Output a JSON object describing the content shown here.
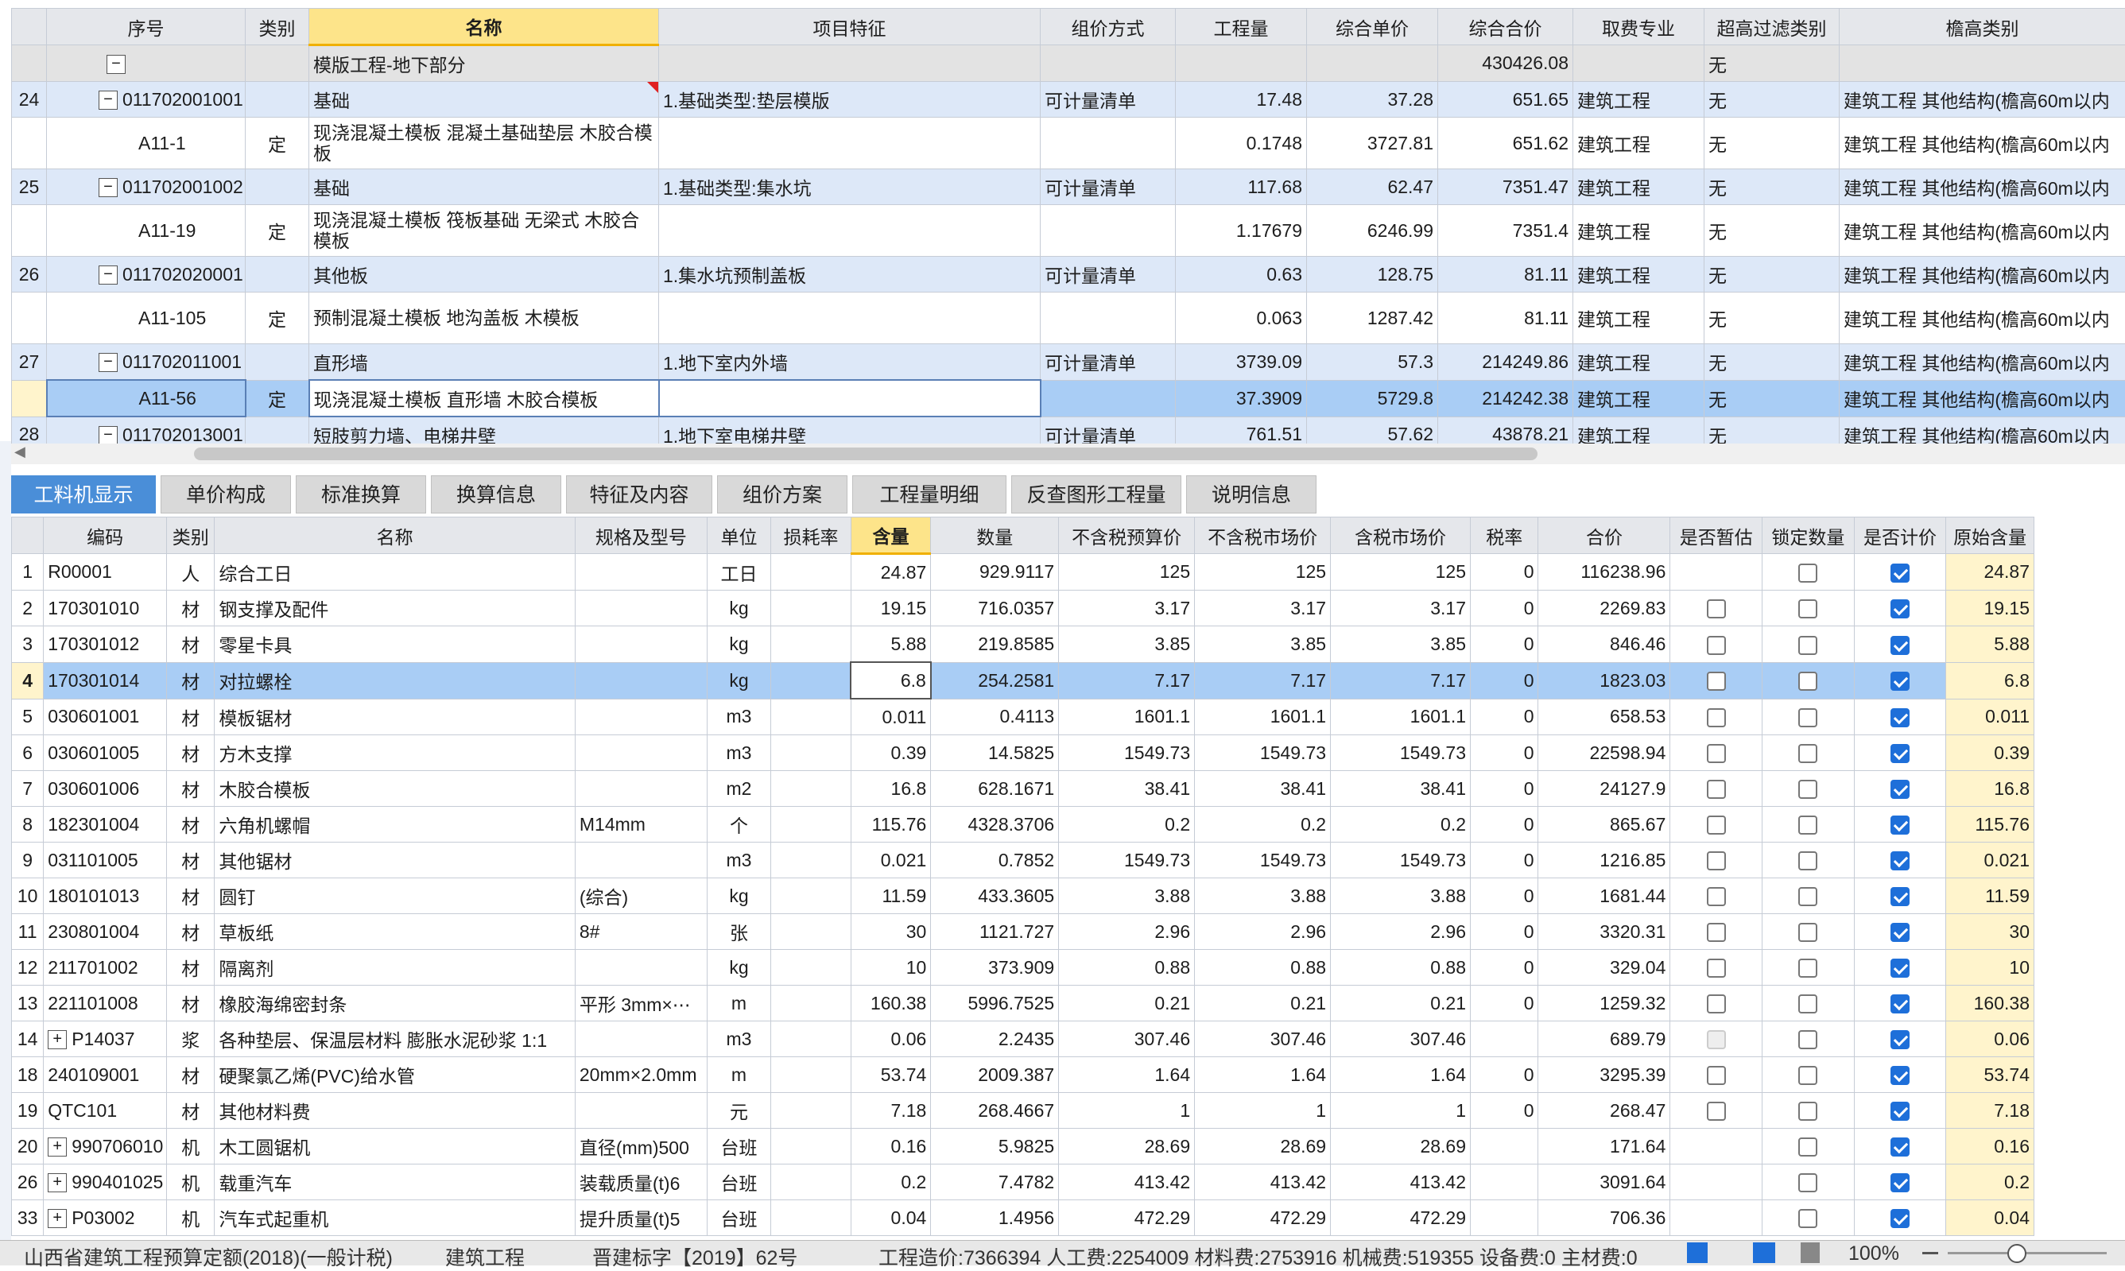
{
  "top_headers": [
    "序号",
    "类别",
    "名称",
    "项目特征",
    "组价方式",
    "工程量",
    "综合单价",
    "综合合价",
    "取费专业",
    "超高过滤类别",
    "檐高类别"
  ],
  "top_rows": [
    {
      "seq": "",
      "code": "",
      "type": "",
      "name": "模版工程-地下部分",
      "feat": "",
      "method": "",
      "qty": "",
      "price": "",
      "total": "430426.08",
      "fee": "",
      "filter": "无",
      "height": "",
      "style": "gray"
    },
    {
      "seq": "24",
      "code": "011702001001",
      "type": "",
      "name": "基础",
      "feat": "1.基础类型:垫层模版",
      "method": "可计量清单",
      "qty": "17.48",
      "price": "37.28",
      "total": "651.65",
      "fee": "建筑工程",
      "filter": "无",
      "height": "建筑工程 其他结构(檐高60m以内",
      "style": "blue"
    },
    {
      "seq": "",
      "code": "A11-1",
      "type": "定",
      "name": "现浇混凝土模板 混凝土基础垫层 木胶合模板",
      "feat": "",
      "method": "",
      "qty": "0.1748",
      "price": "3727.81",
      "total": "651.62",
      "fee": "建筑工程",
      "filter": "无",
      "height": "建筑工程 其他结构(檐高60m以内",
      "style": "white"
    },
    {
      "seq": "25",
      "code": "011702001002",
      "type": "",
      "name": "基础",
      "feat": "1.基础类型:集水坑",
      "method": "可计量清单",
      "qty": "117.68",
      "price": "62.47",
      "total": "7351.47",
      "fee": "建筑工程",
      "filter": "无",
      "height": "建筑工程 其他结构(檐高60m以内",
      "style": "blue"
    },
    {
      "seq": "",
      "code": "A11-19",
      "type": "定",
      "name": "现浇混凝土模板 筏板基础 无梁式 木胶合模板",
      "feat": "",
      "method": "",
      "qty": "1.17679",
      "price": "6246.99",
      "total": "7351.4",
      "fee": "建筑工程",
      "filter": "无",
      "height": "建筑工程 其他结构(檐高60m以内",
      "style": "white"
    },
    {
      "seq": "26",
      "code": "011702020001",
      "type": "",
      "name": "其他板",
      "feat": "1.集水坑预制盖板",
      "method": "可计量清单",
      "qty": "0.63",
      "price": "128.75",
      "total": "81.11",
      "fee": "建筑工程",
      "filter": "无",
      "height": "建筑工程 其他结构(檐高60m以内",
      "style": "blue"
    },
    {
      "seq": "",
      "code": "A11-105",
      "type": "定",
      "name": "预制混凝土模板 地沟盖板 木模板",
      "feat": "",
      "method": "",
      "qty": "0.063",
      "price": "1287.42",
      "total": "81.11",
      "fee": "建筑工程",
      "filter": "无",
      "height": "建筑工程 其他结构(檐高60m以内",
      "style": "white"
    },
    {
      "seq": "27",
      "code": "011702011001",
      "type": "",
      "name": "直形墙",
      "feat": "1.地下室内外墙",
      "method": "可计量清单",
      "qty": "3739.09",
      "price": "57.3",
      "total": "214249.86",
      "fee": "建筑工程",
      "filter": "无",
      "height": "建筑工程 其他结构(檐高60m以内",
      "style": "blue"
    },
    {
      "seq": "",
      "code": "A11-56",
      "type": "定",
      "name": "现浇混凝土模板 直形墙 木胶合模板",
      "feat": "",
      "method": "",
      "qty": "37.3909",
      "price": "5729.8",
      "total": "214242.38",
      "fee": "建筑工程",
      "filter": "无",
      "height": "建筑工程 其他结构(檐高60m以内",
      "style": "selrow"
    },
    {
      "seq": "28",
      "code": "011702013001",
      "type": "",
      "name": "短肢剪力墙、电梯井壁",
      "feat": "1.地下室电梯井壁",
      "method": "可计量清单",
      "qty": "761.51",
      "price": "57.62",
      "total": "43878.21",
      "fee": "建筑工程",
      "filter": "无",
      "height": "建筑工程 其他结构(檐高60m以内",
      "style": "blue"
    }
  ],
  "tabs": [
    "工料机显示",
    "单价构成",
    "标准换算",
    "换算信息",
    "特征及内容",
    "组价方案",
    "工程量明细",
    "反查图形工程量",
    "说明信息"
  ],
  "bottom_headers": [
    "编码",
    "类别",
    "名称",
    "规格及型号",
    "单位",
    "损耗率",
    "含量",
    "数量",
    "不含税预算价",
    "不含税市场价",
    "含税市场价",
    "税率",
    "合价",
    "是否暂估",
    "锁定数量",
    "是否计价",
    "原始含量"
  ],
  "bottom_rows": [
    {
      "n": "1",
      "code": "R00001",
      "exp": false,
      "type": "人",
      "name": "综合工日",
      "spec": "",
      "unit": "工日",
      "loss": "",
      "content": "24.87",
      "qty": "929.9117",
      "p1": "125",
      "p2": "125",
      "p3": "125",
      "tax": "0",
      "sum": "116238.96",
      "est": "none",
      "lock": "off",
      "price": "on",
      "orig": "24.87"
    },
    {
      "n": "2",
      "code": "170301010",
      "exp": false,
      "type": "材",
      "name": "钢支撑及配件",
      "spec": "",
      "unit": "kg",
      "loss": "",
      "content": "19.15",
      "qty": "716.0357",
      "p1": "3.17",
      "p2": "3.17",
      "p3": "3.17",
      "tax": "0",
      "sum": "2269.83",
      "est": "off",
      "lock": "off",
      "price": "on",
      "orig": "19.15"
    },
    {
      "n": "3",
      "code": "170301012",
      "exp": false,
      "type": "材",
      "name": "零星卡具",
      "spec": "",
      "unit": "kg",
      "loss": "",
      "content": "5.88",
      "qty": "219.8585",
      "p1": "3.85",
      "p2": "3.85",
      "p3": "3.85",
      "tax": "0",
      "sum": "846.46",
      "est": "off",
      "lock": "off",
      "price": "on",
      "orig": "5.88"
    },
    {
      "n": "4",
      "code": "170301014",
      "exp": false,
      "type": "材",
      "name": "对拉螺栓",
      "spec": "",
      "unit": "kg",
      "loss": "",
      "content": "6.8",
      "qty": "254.2581",
      "p1": "7.17",
      "p2": "7.17",
      "p3": "7.17",
      "tax": "0",
      "sum": "1823.03",
      "est": "off",
      "lock": "off",
      "price": "on",
      "orig": "6.8",
      "sel": true
    },
    {
      "n": "5",
      "code": "030601001",
      "exp": false,
      "type": "材",
      "name": "模板锯材",
      "spec": "",
      "unit": "m3",
      "loss": "",
      "content": "0.011",
      "qty": "0.4113",
      "p1": "1601.1",
      "p2": "1601.1",
      "p3": "1601.1",
      "tax": "0",
      "sum": "658.53",
      "est": "off",
      "lock": "off",
      "price": "on",
      "orig": "0.011"
    },
    {
      "n": "6",
      "code": "030601005",
      "exp": false,
      "type": "材",
      "name": "方木支撑",
      "spec": "",
      "unit": "m3",
      "loss": "",
      "content": "0.39",
      "qty": "14.5825",
      "p1": "1549.73",
      "p2": "1549.73",
      "p3": "1549.73",
      "tax": "0",
      "sum": "22598.94",
      "est": "off",
      "lock": "off",
      "price": "on",
      "orig": "0.39"
    },
    {
      "n": "7",
      "code": "030601006",
      "exp": false,
      "type": "材",
      "name": "木胶合模板",
      "spec": "",
      "unit": "m2",
      "loss": "",
      "content": "16.8",
      "qty": "628.1671",
      "p1": "38.41",
      "p2": "38.41",
      "p3": "38.41",
      "tax": "0",
      "sum": "24127.9",
      "est": "off",
      "lock": "off",
      "price": "on",
      "orig": "16.8"
    },
    {
      "n": "8",
      "code": "182301004",
      "exp": false,
      "type": "材",
      "name": "六角机螺帽",
      "spec": "M14mm",
      "unit": "个",
      "loss": "",
      "content": "115.76",
      "qty": "4328.3706",
      "p1": "0.2",
      "p2": "0.2",
      "p3": "0.2",
      "tax": "0",
      "sum": "865.67",
      "est": "off",
      "lock": "off",
      "price": "on",
      "orig": "115.76"
    },
    {
      "n": "9",
      "code": "031101005",
      "exp": false,
      "type": "材",
      "name": "其他锯材",
      "spec": "",
      "unit": "m3",
      "loss": "",
      "content": "0.021",
      "qty": "0.7852",
      "p1": "1549.73",
      "p2": "1549.73",
      "p3": "1549.73",
      "tax": "0",
      "sum": "1216.85",
      "est": "off",
      "lock": "off",
      "price": "on",
      "orig": "0.021"
    },
    {
      "n": "10",
      "code": "180101013",
      "exp": false,
      "type": "材",
      "name": "圆钉",
      "spec": "(综合)",
      "unit": "kg",
      "loss": "",
      "content": "11.59",
      "qty": "433.3605",
      "p1": "3.88",
      "p2": "3.88",
      "p3": "3.88",
      "tax": "0",
      "sum": "1681.44",
      "est": "off",
      "lock": "off",
      "price": "on",
      "orig": "11.59"
    },
    {
      "n": "11",
      "code": "230801004",
      "exp": false,
      "type": "材",
      "name": "草板纸",
      "spec": "8#",
      "unit": "张",
      "loss": "",
      "content": "30",
      "qty": "1121.727",
      "p1": "2.96",
      "p2": "2.96",
      "p3": "2.96",
      "tax": "0",
      "sum": "3320.31",
      "est": "off",
      "lock": "off",
      "price": "on",
      "orig": "30"
    },
    {
      "n": "12",
      "code": "211701002",
      "exp": false,
      "type": "材",
      "name": "隔离剂",
      "spec": "",
      "unit": "kg",
      "loss": "",
      "content": "10",
      "qty": "373.909",
      "p1": "0.88",
      "p2": "0.88",
      "p3": "0.88",
      "tax": "0",
      "sum": "329.04",
      "est": "off",
      "lock": "off",
      "price": "on",
      "orig": "10"
    },
    {
      "n": "13",
      "code": "221101008",
      "exp": false,
      "type": "材",
      "name": "橡胶海绵密封条",
      "spec": "平形 3mm×⋯",
      "unit": "m",
      "loss": "",
      "content": "160.38",
      "qty": "5996.7525",
      "p1": "0.21",
      "p2": "0.21",
      "p3": "0.21",
      "tax": "0",
      "sum": "1259.32",
      "est": "off",
      "lock": "off",
      "price": "on",
      "orig": "160.38"
    },
    {
      "n": "14",
      "code": "P14037",
      "exp": true,
      "type": "浆",
      "name": "各种垫层、保温层材料 膨胀水泥砂浆 1:1",
      "spec": "",
      "unit": "m3",
      "loss": "",
      "content": "0.06",
      "qty": "2.2435",
      "p1": "307.46",
      "p2": "307.46",
      "p3": "307.46",
      "tax": "",
      "sum": "689.79",
      "est": "dis",
      "lock": "off",
      "price": "on",
      "orig": "0.06"
    },
    {
      "n": "18",
      "code": "240109001",
      "exp": false,
      "type": "材",
      "name": "硬聚氯乙烯(PVC)给水管",
      "spec": "20mm×2.0mm",
      "unit": "m",
      "loss": "",
      "content": "53.74",
      "qty": "2009.387",
      "p1": "1.64",
      "p2": "1.64",
      "p3": "1.64",
      "tax": "0",
      "sum": "3295.39",
      "est": "off",
      "lock": "off",
      "price": "on",
      "orig": "53.74"
    },
    {
      "n": "19",
      "code": "QTC101",
      "exp": false,
      "type": "材",
      "name": "其他材料费",
      "spec": "",
      "unit": "元",
      "loss": "",
      "content": "7.18",
      "qty": "268.4667",
      "p1": "1",
      "p2": "1",
      "p3": "1",
      "tax": "0",
      "sum": "268.47",
      "est": "off",
      "lock": "off",
      "price": "on",
      "orig": "7.18"
    },
    {
      "n": "20",
      "code": "990706010",
      "exp": true,
      "type": "机",
      "name": "木工圆锯机",
      "spec": "直径(mm)500",
      "unit": "台班",
      "loss": "",
      "content": "0.16",
      "qty": "5.9825",
      "p1": "28.69",
      "p2": "28.69",
      "p3": "28.69",
      "tax": "",
      "sum": "171.64",
      "est": "none",
      "lock": "off",
      "price": "on",
      "orig": "0.16"
    },
    {
      "n": "26",
      "code": "990401025",
      "exp": true,
      "type": "机",
      "name": "载重汽车",
      "spec": "装载质量(t)6",
      "unit": "台班",
      "loss": "",
      "content": "0.2",
      "qty": "7.4782",
      "p1": "413.42",
      "p2": "413.42",
      "p3": "413.42",
      "tax": "",
      "sum": "3091.64",
      "est": "none",
      "lock": "off",
      "price": "on",
      "orig": "0.2"
    },
    {
      "n": "33",
      "code": "P03002",
      "exp": true,
      "type": "机",
      "name": "汽车式起重机",
      "spec": "提升质量(t)5",
      "unit": "台班",
      "loss": "",
      "content": "0.04",
      "qty": "1.4956",
      "p1": "472.29",
      "p2": "472.29",
      "p3": "472.29",
      "tax": "",
      "sum": "706.36",
      "est": "none",
      "lock": "off",
      "price": "on",
      "orig": "0.04"
    }
  ],
  "status": {
    "quota": "山西省建筑工程预算定额(2018)(一般计税)",
    "major": "建筑工程",
    "doc": "晋建标字【2019】62号",
    "summary": "工程造价:7366394  人工费:2254009  材料费:2753916  机械费:519355  设备费:0  主材费:0",
    "zoom": "100%"
  }
}
